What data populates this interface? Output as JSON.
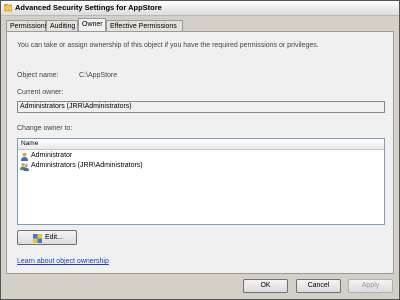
{
  "window": {
    "title": "Advanced Security Settings for AppStore"
  },
  "tabs": [
    {
      "label": "Permissions"
    },
    {
      "label": "Auditing"
    },
    {
      "label": "Owner",
      "selected": true
    },
    {
      "label": "Effective Permissions"
    }
  ],
  "owner": {
    "intro": "You can take or assign ownership of this object if you have the required permissions or privileges.",
    "object_name_label": "Object name:",
    "object_name_value": "C:\\AppStore",
    "current_owner_label": "Current owner:",
    "current_owner_value": "Administrators (JRR\\Administrators)",
    "change_owner_label": "Change owner to:",
    "list_header": "Name",
    "list_items": [
      {
        "name": "Administrator",
        "icon": "user-icon"
      },
      {
        "name": "Administrators (JRR\\Administrators)",
        "icon": "group-icon"
      }
    ],
    "edit_button": "Edit...",
    "learn_link": "Learn about object ownership"
  },
  "footer": {
    "ok": "OK",
    "cancel": "Cancel",
    "apply": "Apply"
  },
  "colors": {
    "link": "#1a3ec0",
    "panel": "#f0f0f0",
    "frame": "#d4d0c8"
  }
}
